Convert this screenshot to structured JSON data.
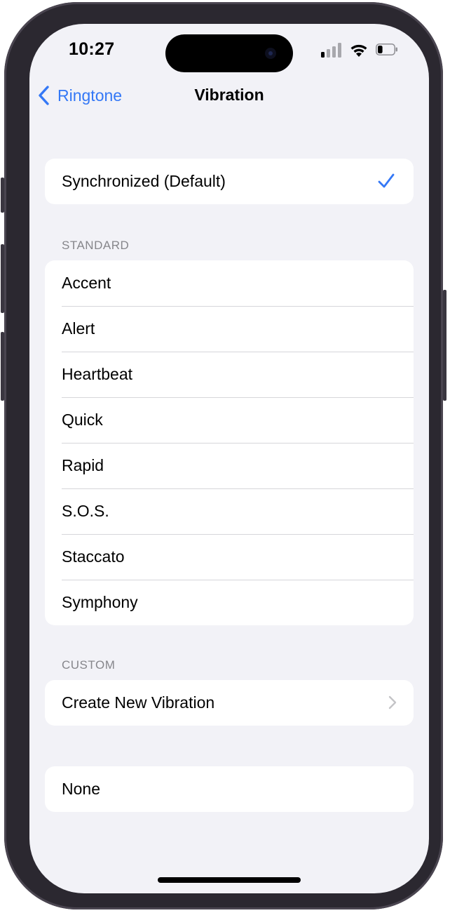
{
  "status_bar": {
    "time": "10:27",
    "signal_icon": "cellular-signal-icon",
    "wifi_icon": "wifi-icon",
    "battery_icon": "battery-icon",
    "signal_bars_active": 1,
    "signal_bars_total": 4,
    "battery_level": 0.3
  },
  "nav": {
    "back_label": "Ringtone",
    "back_icon": "chevron-left-icon",
    "title": "Vibration"
  },
  "default_group": {
    "items": [
      {
        "label": "Synchronized (Default)",
        "selected": true
      }
    ]
  },
  "standard": {
    "header": "STANDARD",
    "items": [
      {
        "label": "Accent"
      },
      {
        "label": "Alert"
      },
      {
        "label": "Heartbeat"
      },
      {
        "label": "Quick"
      },
      {
        "label": "Rapid"
      },
      {
        "label": "S.O.S."
      },
      {
        "label": "Staccato"
      },
      {
        "label": "Symphony"
      }
    ]
  },
  "custom": {
    "header": "CUSTOM",
    "items": [
      {
        "label": "Create New Vibration",
        "icon": "chevron-right-icon"
      }
    ]
  },
  "none_group": {
    "items": [
      {
        "label": "None"
      }
    ]
  },
  "colors": {
    "accent": "#3478f6",
    "background": "#f2f2f7",
    "card": "#ffffff",
    "secondary_text": "#86868b",
    "separator": "#d6d6da",
    "chevron": "#c4c4c7"
  }
}
